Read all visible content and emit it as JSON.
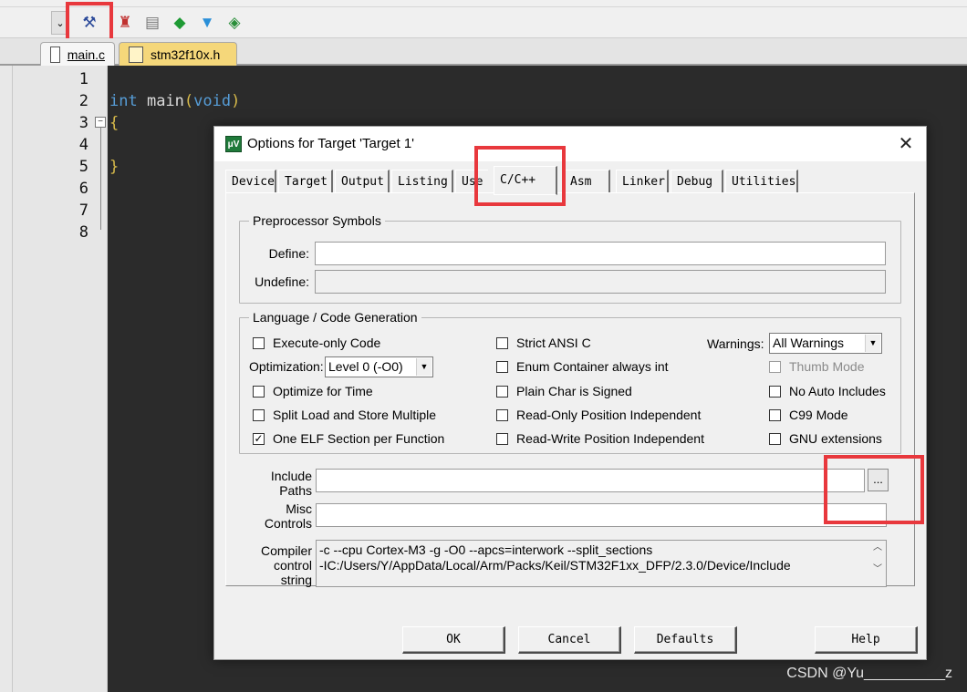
{
  "ide": {
    "toolbar_icons": [
      "options-for-target-icon",
      "load-icon",
      "copy-icon",
      "diamond-icon",
      "download-icon",
      "pack-installer-icon"
    ],
    "file_tabs": [
      {
        "label": "main.c",
        "icon": "c-file-icon",
        "active": true
      },
      {
        "label": "stm32f10x.h",
        "icon": "h-file-icon",
        "active": false
      }
    ],
    "line_numbers": [
      "1",
      "2",
      "3",
      "4",
      "5",
      "6",
      "7",
      "8"
    ],
    "code": {
      "line2_kw": "int",
      "line2_fn": " main",
      "line2_open": "(",
      "line2_void": "void",
      "line2_close": ")",
      "line3": "{",
      "line5": "}"
    },
    "fold_glyph": "−",
    "watermark": "CSDN @Yu__________z"
  },
  "dialog": {
    "title": "Options for Target 'Target 1'",
    "close": "✕",
    "tabs": [
      "Device",
      "Target",
      "Output",
      "Listing",
      "Use",
      "C/C++",
      "Asm",
      "Linker",
      "Debug",
      "Utilities"
    ],
    "active_tab": "C/C++",
    "preprocessor": {
      "title": "Preprocessor Symbols",
      "define_label": "Define:",
      "define_value": "",
      "undefine_label": "Undefine:",
      "undefine_value": ""
    },
    "codegen": {
      "title": "Language / Code Generation",
      "execute_only": "Execute-only Code",
      "optimization_label": "Optimization:",
      "optimization_value": "Level 0 (-O0)",
      "optimize_time": "Optimize for Time",
      "split_load": "Split Load and Store Multiple",
      "one_elf": "One ELF Section per Function",
      "strict_ansi": "Strict ANSI C",
      "enum_container": "Enum Container always int",
      "plain_char": "Plain Char is Signed",
      "ro_pi": "Read-Only Position Independent",
      "rw_pi": "Read-Write Position Independent",
      "warnings_label": "Warnings:",
      "warnings_value": "All Warnings",
      "thumb_mode": "Thumb Mode",
      "no_auto_includes": "No Auto Includes",
      "c99_mode": "C99 Mode",
      "gnu_ext": "GNU extensions",
      "check_mark": "✓"
    },
    "include_paths_label": "Include\nPaths",
    "include_paths_value": "",
    "ellipsis": "...",
    "misc_label": "Misc\nControls",
    "misc_value": "",
    "compiler_label": "Compiler\ncontrol\nstring",
    "compiler_line1": "-c --cpu Cortex-M3 -g -O0 --apcs=interwork --split_sections",
    "compiler_line2": "-IC:/Users/Y/AppData/Local/Arm/Packs/Keil/STM32F1xx_DFP/2.3.0/Device/Include",
    "buttons": {
      "ok": "OK",
      "cancel": "Cancel",
      "defaults": "Defaults",
      "help": "Help"
    }
  }
}
